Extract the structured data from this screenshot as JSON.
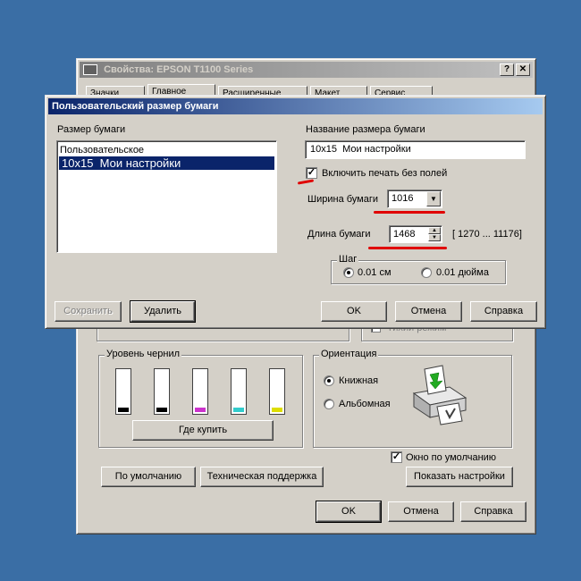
{
  "main_dialog": {
    "title": "Свойства: EPSON T1100 Series",
    "help_btn": "?",
    "close_btn": "✕",
    "tabs": [
      "Значки",
      "Главное",
      "Расширенные",
      "Макет",
      "Сервис"
    ],
    "hidden_row_text": "Тихий режим",
    "ink_group": {
      "label": "Уровень чернил",
      "buy_button": "Где купить"
    },
    "ink_colors": [
      "#000000",
      "#000000",
      "#cc33cc",
      "#33cccc",
      "#dddd00"
    ],
    "orientation": {
      "label": "Ориентация",
      "portrait": "Книжная",
      "landscape": "Альбомная"
    },
    "default_window_label": "Окно по умолчанию",
    "buttons": {
      "default": "По умолчанию",
      "support": "Техническая поддержка",
      "show_settings": "Показать настройки",
      "ok": "OK",
      "cancel": "Отмена",
      "help": "Справка"
    }
  },
  "paper_dialog": {
    "title": "Пользовательский размер бумаги",
    "paper_size_label": "Размер бумаги",
    "paper_list": [
      "Пользовательское",
      "10x15  Мои настройки"
    ],
    "selected_index": 1,
    "name_label": "Название размера бумаги",
    "name_value": "10x15  Мои настройки",
    "borderless_label": "Включить печать без полей",
    "width_label": "Ширина бумаги",
    "width_value": "1016",
    "length_label": "Длина бумаги",
    "length_value": "1468",
    "length_range": "[ 1270 ... 11176]",
    "step_group_label": "Шаг",
    "step_cm": "0.01 см",
    "step_inch": "0.01 дюйма",
    "buttons": {
      "save": "Сохранить",
      "delete": "Удалить",
      "ok": "OK",
      "cancel": "Отмена",
      "help": "Справка"
    }
  },
  "colors": {
    "annotation_red": "#e00000",
    "active_title": "#0a246a"
  }
}
